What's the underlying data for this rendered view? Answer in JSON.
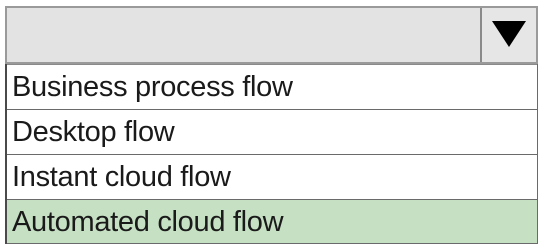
{
  "dropdown": {
    "selected_value": "",
    "arrow_icon": "triangle-down-icon",
    "options": [
      {
        "label": "Business process flow",
        "highlighted": false
      },
      {
        "label": "Desktop flow",
        "highlighted": false
      },
      {
        "label": "Instant cloud flow",
        "highlighted": false
      },
      {
        "label": "Automated cloud flow",
        "highlighted": true
      }
    ],
    "colors": {
      "select_background": "#e3e3e3",
      "highlight_background": "#c6e0c3",
      "text": "#1a1a1a"
    }
  }
}
